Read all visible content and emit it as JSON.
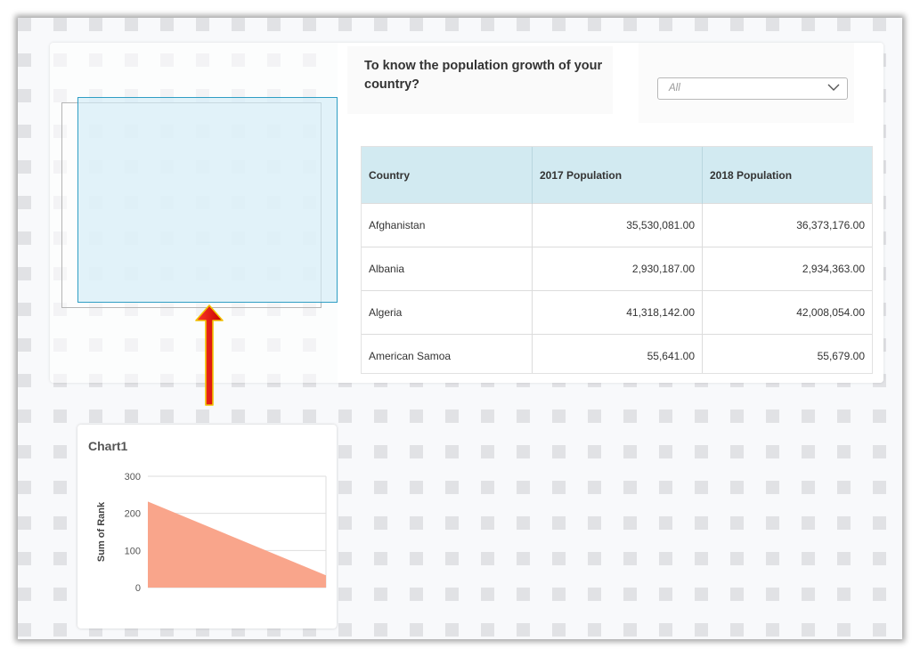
{
  "question": "To know the population growth of your country?",
  "filter": {
    "selected": "All"
  },
  "table": {
    "headers": [
      "Country",
      "2017 Population",
      "2018 Population"
    ],
    "rows": [
      [
        "Afghanistan",
        "35,530,081.00",
        "36,373,176.00"
      ],
      [
        "Albania",
        "2,930,187.00",
        "2,934,363.00"
      ],
      [
        "Algeria",
        "41,318,142.00",
        "42,008,054.00"
      ],
      [
        "American Samoa",
        "55,641.00",
        "55,679.00"
      ]
    ]
  },
  "chart_data": {
    "type": "area",
    "title": "Chart1",
    "xlabel": "",
    "ylabel": "Sum of Rank",
    "ylim": [
      0,
      300
    ],
    "yticks": [
      "300",
      "200",
      "100",
      "0"
    ],
    "values": [
      232,
      33
    ],
    "color": "#f9a58b"
  },
  "colors": {
    "header_bg": "#d2eaf1",
    "selection_border": "#2f9ec4",
    "arrow": "#e00000"
  }
}
